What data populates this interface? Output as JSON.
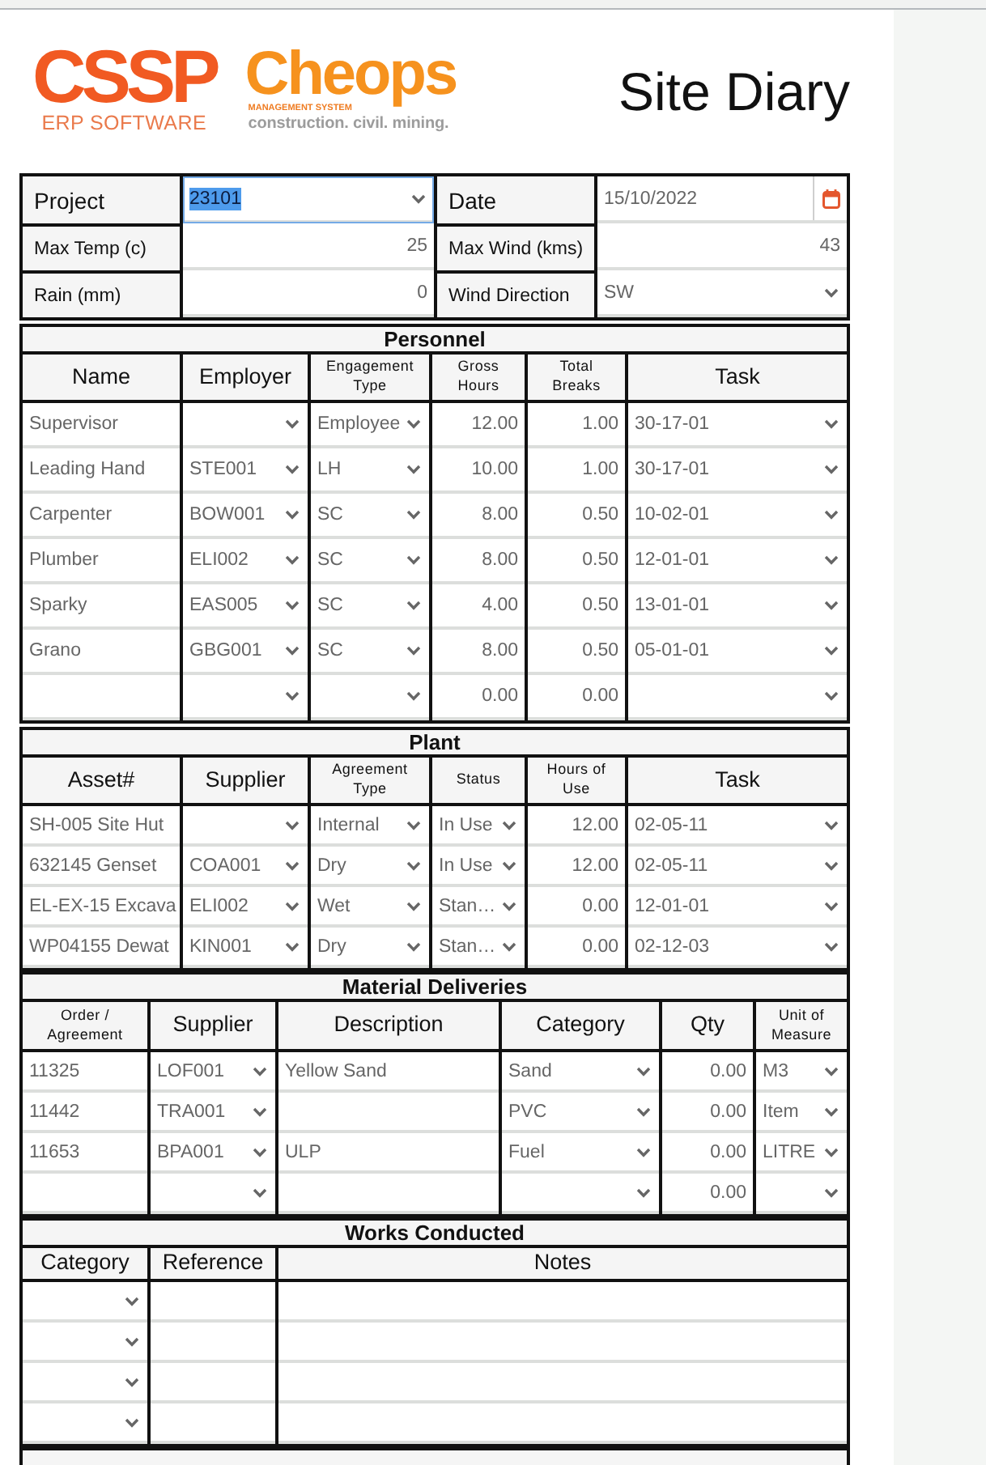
{
  "header": {
    "logo": {
      "wordmark": "CSSP",
      "wordmark_sub": "ERP SOFTWARE",
      "product": "Cheops",
      "product_tag": "MANAGEMENT SYSTEM",
      "product_sub": "construction. civil. mining."
    },
    "title": "Site Diary"
  },
  "summary": [
    {
      "label": "Project",
      "kind": "select",
      "value": "23101",
      "focused": true
    },
    {
      "label": "Date",
      "kind": "date",
      "value": "15/10/2022",
      "focused": false
    },
    {
      "label": "Max Temp (c)",
      "kind": "number",
      "value": "25",
      "focused": false
    },
    {
      "label": "Max Wind (kms)",
      "kind": "number",
      "value": "43",
      "focused": false
    },
    {
      "label": "Rain (mm)",
      "kind": "number",
      "value": "0",
      "focused": false
    },
    {
      "label": "Wind Direction",
      "kind": "select",
      "value": "SW",
      "focused": false
    }
  ],
  "sections": [
    {
      "title": "Personnel",
      "columns": [
        {
          "label": "Name",
          "kind": "text",
          "small": false
        },
        {
          "label": "Employer",
          "kind": "select",
          "small": false
        },
        {
          "label": "Engagement Type",
          "kind": "select",
          "small": true
        },
        {
          "label": "Gross Hours",
          "kind": "number",
          "small": true
        },
        {
          "label": "Total Breaks",
          "kind": "number",
          "small": true
        },
        {
          "label": "Task",
          "kind": "select",
          "small": false
        }
      ],
      "rows": [
        [
          "Supervisor",
          null,
          "Employee",
          "12.00",
          "1.00",
          "30-17-01"
        ],
        [
          "Leading Hand",
          "STE001",
          "LH",
          "10.00",
          "1.00",
          "30-17-01"
        ],
        [
          "Carpenter",
          "BOW001",
          "SC",
          "8.00",
          "0.50",
          "10-02-01"
        ],
        [
          "Plumber",
          "ELI002",
          "SC",
          "8.00",
          "0.50",
          "12-01-01"
        ],
        [
          "Sparky",
          "EAS005",
          "SC",
          "4.00",
          "0.50",
          "13-01-01"
        ],
        [
          "Grano",
          "GBG001",
          "SC",
          "8.00",
          "0.50",
          "05-01-01"
        ],
        [
          null,
          null,
          null,
          "0.00",
          "0.00",
          null
        ]
      ]
    },
    {
      "title": "Plant",
      "columns": [
        {
          "label": "Asset#",
          "kind": "text",
          "small": false
        },
        {
          "label": "Supplier",
          "kind": "select",
          "small": false
        },
        {
          "label": "Agreement Type",
          "kind": "select",
          "small": true
        },
        {
          "label": "Status",
          "kind": "select",
          "small": true
        },
        {
          "label": "Hours of Use",
          "kind": "number",
          "small": true
        },
        {
          "label": "Task",
          "kind": "select",
          "small": false
        }
      ],
      "rows": [
        [
          "SH-005 Site Hut",
          null,
          "Internal",
          "In Use",
          "12.00",
          "02-05-11"
        ],
        [
          "632145 Genset",
          "COA001",
          "Dry",
          "In Use",
          "12.00",
          "02-05-11"
        ],
        [
          "EL-EX-15 Excava",
          "ELI002",
          "Wet",
          "Stan…",
          "0.00",
          "12-01-01"
        ],
        [
          "WP04155 Dewat",
          "KIN001",
          "Dry",
          "Stan…",
          "0.00",
          "02-12-03"
        ]
      ]
    },
    {
      "title": "Material Deliveries",
      "columns": [
        {
          "label": "Order / Agreement",
          "kind": "text",
          "small": true
        },
        {
          "label": "Supplier",
          "kind": "select",
          "small": false
        },
        {
          "label": "Description",
          "kind": "text",
          "small": false
        },
        {
          "label": "Category",
          "kind": "select",
          "small": false
        },
        {
          "label": "Qty",
          "kind": "number",
          "small": false
        },
        {
          "label": "Unit of Measure",
          "kind": "select",
          "small": true
        }
      ],
      "rows": [
        [
          "11325",
          "LOF001",
          "Yellow Sand",
          "Sand",
          "0.00",
          "M3"
        ],
        [
          "11442",
          "TRA001",
          null,
          "PVC",
          "0.00",
          "Item"
        ],
        [
          "11653",
          "BPA001",
          "ULP",
          "Fuel",
          "0.00",
          "LITRE"
        ],
        [
          null,
          null,
          null,
          null,
          "0.00",
          null
        ]
      ]
    },
    {
      "title": "Works Conducted",
      "columns": [
        {
          "label": "Category",
          "kind": "select",
          "small": false
        },
        {
          "label": "Reference",
          "kind": "text",
          "small": false
        },
        {
          "label": "Notes",
          "kind": "text",
          "small": false
        }
      ],
      "rows": [
        [
          null,
          null,
          null
        ],
        [
          null,
          null,
          null
        ],
        [
          null,
          null,
          null
        ],
        [
          null,
          null,
          null
        ]
      ]
    }
  ]
}
